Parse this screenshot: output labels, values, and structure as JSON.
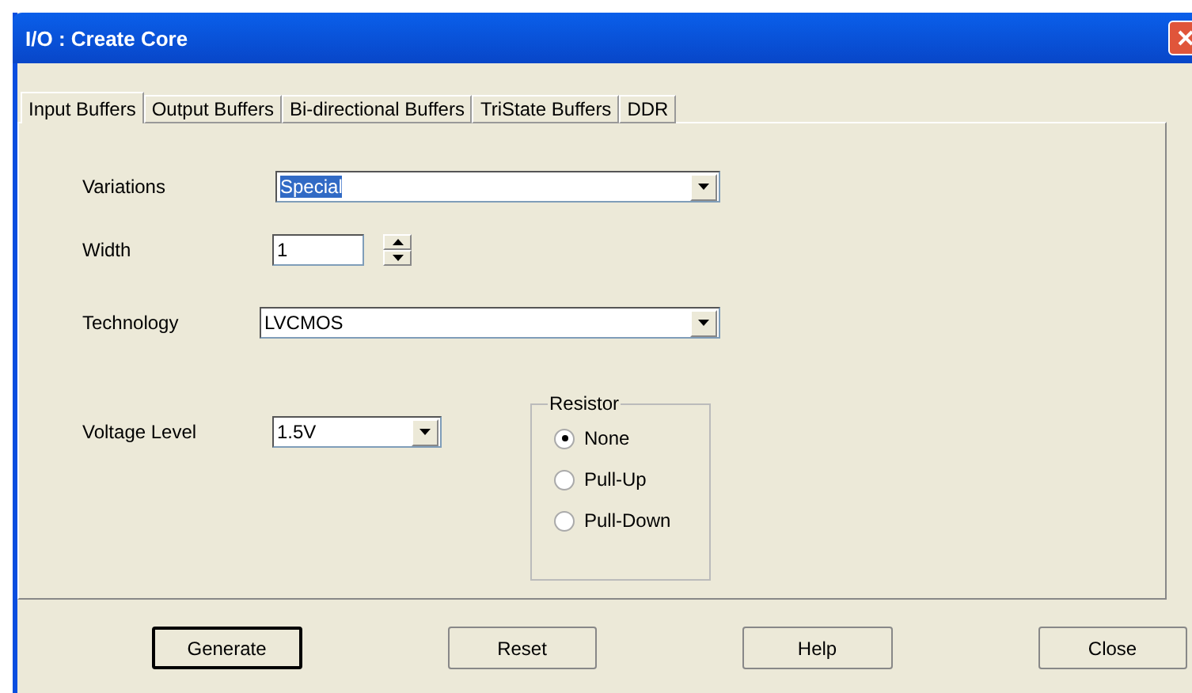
{
  "window": {
    "title": "I/O : Create Core"
  },
  "tabs": [
    {
      "label": "Input Buffers",
      "selected": true
    },
    {
      "label": "Output Buffers",
      "selected": false
    },
    {
      "label": "Bi-directional Buffers",
      "selected": false
    },
    {
      "label": "TriState Buffers",
      "selected": false
    },
    {
      "label": "DDR",
      "selected": false
    }
  ],
  "fields": [
    {
      "kind": "combo",
      "label": "Variations",
      "value": "Special",
      "highlighted": true
    },
    {
      "kind": "spin",
      "label": "Width",
      "value": "1",
      "highlighted": false
    },
    {
      "kind": "combo",
      "label": "Technology",
      "value": "LVCMOS",
      "highlighted": false
    }
  ],
  "voltage": {
    "label": "Voltage Level",
    "value": "1.5V"
  },
  "resistor": {
    "title": "Resistor",
    "options": [
      {
        "label": "None",
        "selected": true
      },
      {
        "label": "Pull-Up",
        "selected": false
      },
      {
        "label": "Pull-Down",
        "selected": false
      }
    ]
  },
  "buttons": [
    {
      "label": "Generate",
      "default": true
    },
    {
      "label": "Reset",
      "default": false
    },
    {
      "label": "Help",
      "default": false
    },
    {
      "label": "Close",
      "default": false
    }
  ]
}
